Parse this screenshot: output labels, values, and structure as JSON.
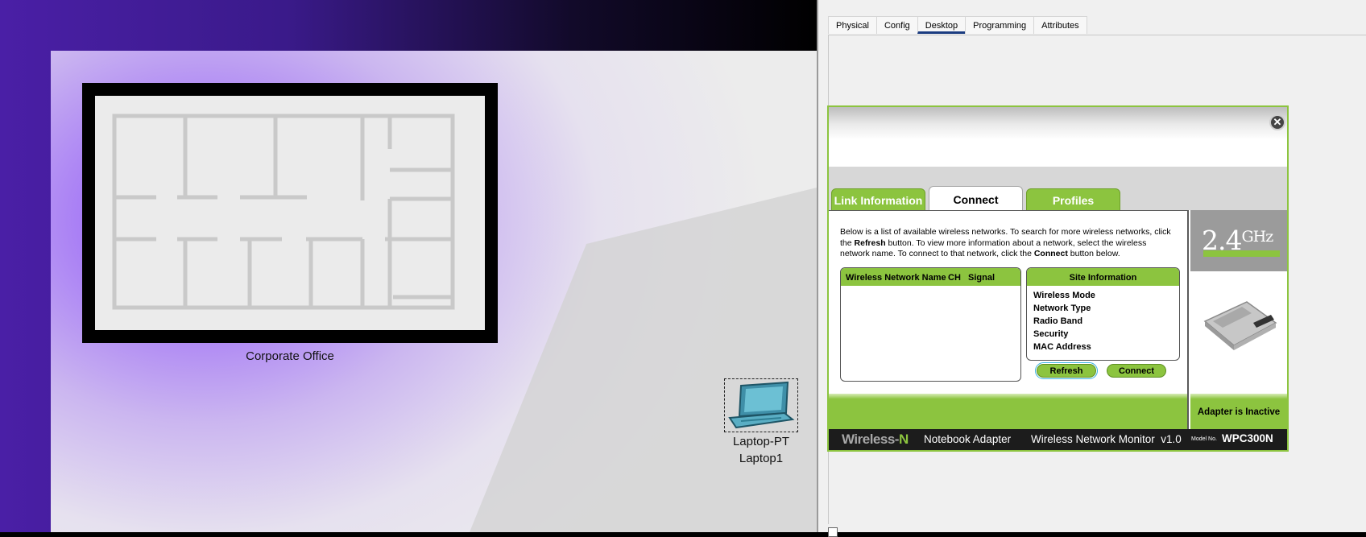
{
  "workspace": {
    "office_label": "Corporate Office",
    "device_type": "Laptop-PT",
    "device_name": "Laptop1"
  },
  "panel": {
    "tabs": [
      {
        "label": "Physical",
        "active": false
      },
      {
        "label": "Config",
        "active": false
      },
      {
        "label": "Desktop",
        "active": true
      },
      {
        "label": "Programming",
        "active": false
      },
      {
        "label": "Attributes",
        "active": false
      }
    ]
  },
  "monitor": {
    "close_symbol": "✕",
    "tabs": {
      "link_information": "Link Information",
      "connect": "Connect",
      "profiles": "Profiles"
    },
    "description": {
      "part1": "Below is a list of available wireless networks. To search for more wireless networks, click the ",
      "bold1": "Refresh",
      "part2": " button. To view more information about a network, select the wireless network name. To connect to that network, click the ",
      "bold2": "Connect",
      "part3": " button below."
    },
    "network_list": {
      "columns": {
        "name": "Wireless Network Name",
        "ch": "CH",
        "signal": "Signal"
      }
    },
    "site_info": {
      "title": "Site Information",
      "rows": {
        "mode": "Wireless Mode",
        "type": "Network Type",
        "band": "Radio Band",
        "security": "Security",
        "mac": "MAC Address"
      }
    },
    "buttons": {
      "refresh": "Refresh",
      "connect": "Connect"
    },
    "band": {
      "value": "2.4",
      "unit": "GHz"
    },
    "adapter_status": "Adapter is Inactive",
    "footer": {
      "brand_main": "Wireless-",
      "brand_n": "N",
      "product": "Notebook Adapter",
      "monitor_title": "Wireless Network Monitor  v1.0",
      "model_label": "Model No.",
      "model_number": "WPC300N"
    }
  },
  "colors": {
    "accent_green": "#8cc43f",
    "tab_underline": "#1b3c80",
    "workspace_purple": "#9a6cf6"
  }
}
